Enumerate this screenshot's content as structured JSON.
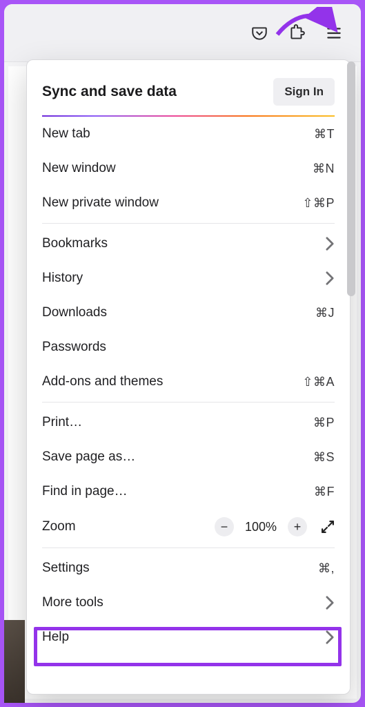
{
  "header": {
    "title": "Sync and save data",
    "signin": "Sign In"
  },
  "groups": [
    [
      {
        "id": "new-tab",
        "label": "New tab",
        "accel": "⌘T"
      },
      {
        "id": "new-window",
        "label": "New window",
        "accel": "⌘N"
      },
      {
        "id": "new-private-window",
        "label": "New private window",
        "accel": "⇧⌘P"
      }
    ],
    [
      {
        "id": "bookmarks",
        "label": "Bookmarks",
        "submenu": true
      },
      {
        "id": "history",
        "label": "History",
        "submenu": true
      },
      {
        "id": "downloads",
        "label": "Downloads",
        "accel": "⌘J"
      },
      {
        "id": "passwords",
        "label": "Passwords"
      },
      {
        "id": "addons",
        "label": "Add-ons and themes",
        "accel": "⇧⌘A"
      }
    ],
    [
      {
        "id": "print",
        "label": "Print…",
        "accel": "⌘P"
      },
      {
        "id": "save-as",
        "label": "Save page as…",
        "accel": "⌘S"
      },
      {
        "id": "find",
        "label": "Find in page…",
        "accel": "⌘F"
      }
    ]
  ],
  "zoom": {
    "label": "Zoom",
    "value": "100%"
  },
  "groups_after_zoom": [
    [
      {
        "id": "settings",
        "label": "Settings",
        "accel": "⌘,"
      },
      {
        "id": "more-tools",
        "label": "More tools",
        "submenu": true
      },
      {
        "id": "help",
        "label": "Help",
        "submenu": true
      }
    ]
  ]
}
